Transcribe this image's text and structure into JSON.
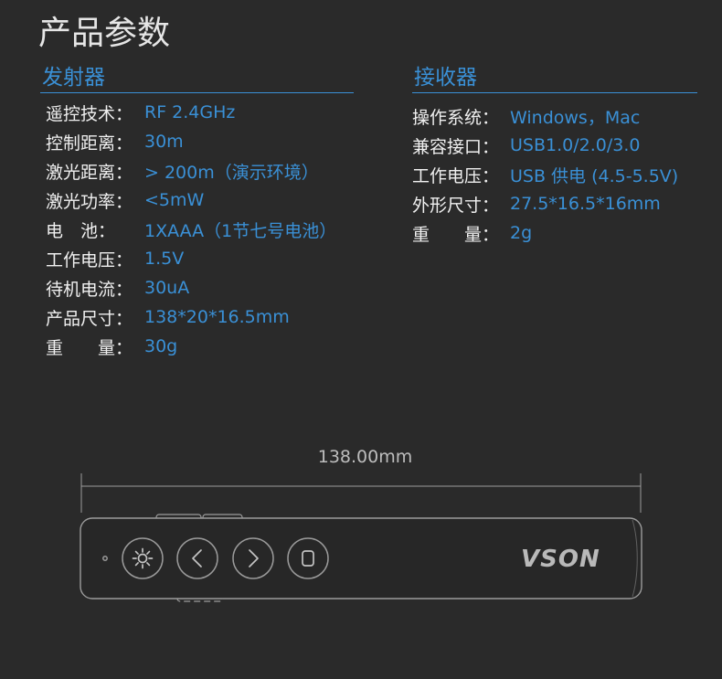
{
  "title": "产品参数",
  "colors": {
    "background": "#2a2a2a",
    "accent": "#3a90d6",
    "title": "#e6e6e6",
    "label": "#f0f0f0",
    "line": "#9c9c9c",
    "logo": "#b9b9b9"
  },
  "transmitter": {
    "heading": "发射器",
    "rows": [
      {
        "label": "遥控技术：",
        "value": "RF 2.4GHz"
      },
      {
        "label": "控制距离：",
        "value": "30m"
      },
      {
        "label": "激光距离：",
        "value": "> 200m（演示环境）"
      },
      {
        "label": "激光功率：",
        "value": "<5mW"
      },
      {
        "label": "电　池：",
        "value": "1XAAA（1节七号电池）"
      },
      {
        "label": "工作电压：",
        "value": "1.5V"
      },
      {
        "label": "待机电流：",
        "value": "30uA"
      },
      {
        "label": "产品尺寸：",
        "value": "138*20*16.5mm"
      },
      {
        "label": "重　　量：",
        "value": "30g"
      }
    ]
  },
  "receiver": {
    "heading": "接收器",
    "rows": [
      {
        "label": "操作系统：",
        "value": "Windows，Mac"
      },
      {
        "label": "兼容接口：",
        "value": "USB1.0/2.0/3.0"
      },
      {
        "label": "工作电压：",
        "value": "USB 供电 (4.5-5.5V)"
      },
      {
        "label": "外形尺寸：",
        "value": "27.5*16.5*16mm"
      },
      {
        "label": "重　　量：",
        "value": "2g"
      }
    ]
  },
  "drawing": {
    "dimension_label": "138.00mm",
    "logo": "VSON",
    "button_icons": [
      "sun-icon",
      "chevron-left-icon",
      "chevron-right-icon",
      "rounded-square-icon"
    ]
  }
}
